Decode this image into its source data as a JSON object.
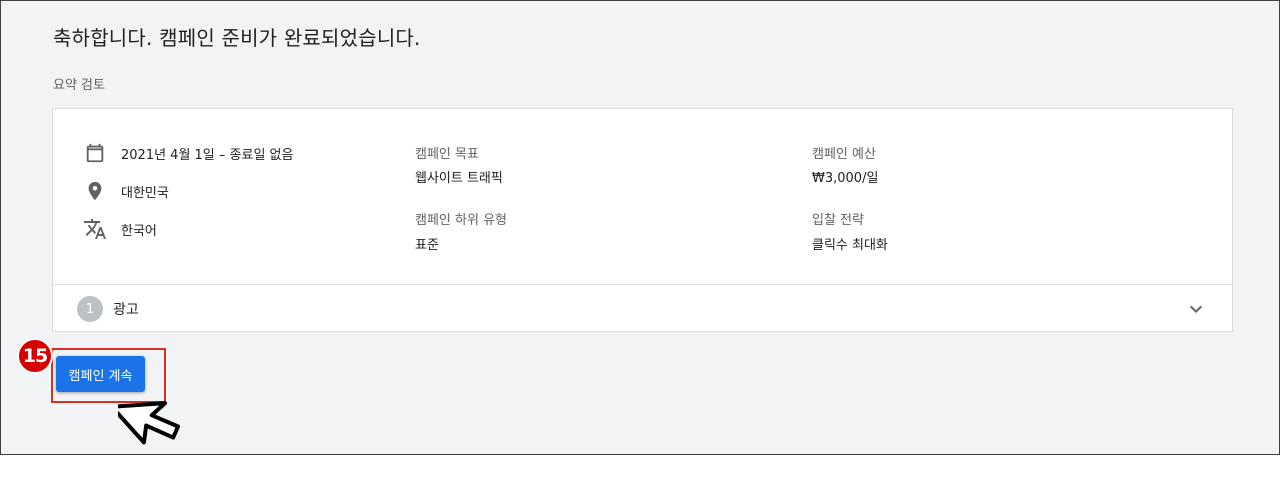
{
  "headline": "축하합니다. 캠페인 준비가 완료되었습니다.",
  "summary_label": "요약 검토",
  "details": {
    "date": "2021년 4월 1일 – 종료일 없음",
    "location": "대한민국",
    "language": "한국어"
  },
  "icons": {
    "date": "calendar-icon",
    "location": "location-pin-icon",
    "language": "translate-icon",
    "expand": "chevron-down-icon"
  },
  "fields": {
    "goal_title": "캠페인 목표",
    "goal_value": "웹사이트 트래픽",
    "subtype_title": "캠페인 하위 유형",
    "subtype_value": "표준",
    "budget_title": "캠페인 예산",
    "budget_value": "₩3,000/일",
    "bidding_title": "입찰 전략",
    "bidding_value": "클릭수 최대화"
  },
  "ads_section": {
    "step": "1",
    "label": "광고"
  },
  "continue_button": "캠페인 계속",
  "annotation": {
    "step_number": "15",
    "highlight_color": "#d93025"
  },
  "colors": {
    "accent": "#1a73e8",
    "background": "#f1f3f4"
  }
}
